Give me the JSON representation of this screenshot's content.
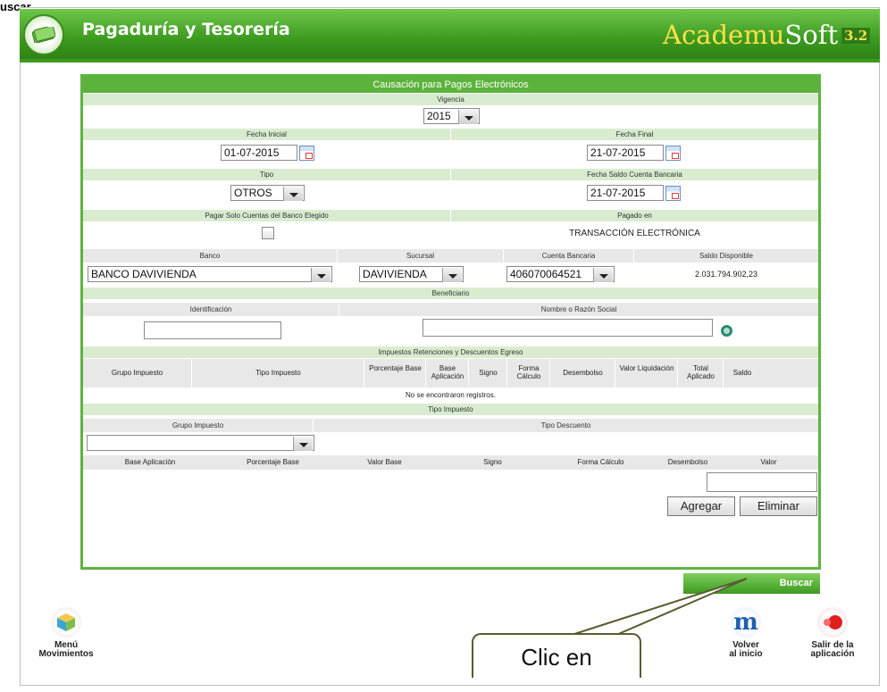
{
  "top_caption": "uscar.",
  "header": {
    "title": "Pagaduría y Tesorería",
    "brand_a": "Academu",
    "brand_b": "Soft",
    "brand_version": "3.2"
  },
  "form": {
    "title": "Causación para Pagos Electrónicos",
    "vigencia_label": "Vigencia",
    "vigencia_value": "2015",
    "fecha_inicial_label": "Fecha Inicial",
    "fecha_inicial_value": "01-07-2015",
    "fecha_final_label": "Fecha Final",
    "fecha_final_value": "21-07-2015",
    "tipo_label": "Tipo",
    "tipo_value": "OTROS",
    "fecha_saldo_label": "Fecha Saldo Cuenta Bancaria",
    "fecha_saldo_value": "21-07-2015",
    "pagar_label": "Pagar Solo Cuentas del Banco Elegido",
    "pagado_label": "Pagado en",
    "pagado_value": "TRANSACCIÓN ELECTRÓNICA",
    "banco_label": "Banco",
    "banco_value": "BANCO DAVIVIENDA",
    "sucursal_label": "Sucursal",
    "sucursal_value": "DAVIVIENDA",
    "cuenta_label": "Cuenta Bancaria",
    "cuenta_value": "406070064521",
    "saldo_label": "Saldo Disponible",
    "saldo_value": "2.031.794.902,23",
    "beneficiario_label": "Beneficiario",
    "identificacion_label": "Identificación",
    "nombre_label": "Nombre o Razón Social",
    "impuestos_label": "Impuestos Retenciones y Descuentos Egreso",
    "impuestos_columns": [
      "Grupo Impuesto",
      "Tipo Impuesto",
      "Porcentaje Base",
      "Base Aplicación",
      "Signo",
      "Forma Cálculo",
      "Desembolso",
      "Valor Liquidación",
      "Total Aplicado",
      "Saldo"
    ],
    "no_records": "No se encontraron registros.",
    "tipo_impuesto_label": "Tipo Impuesto",
    "grupo_impuesto_label": "Grupo Impuesto",
    "tipo_descuento_label": "Tipo Descuento",
    "detalle_columns": [
      "Base Aplicación",
      "Porcentaje Base",
      "Valor Base",
      "Signo",
      "Forma Cálculo",
      "Desembolso",
      "Valor"
    ],
    "agregar_label": "Agregar",
    "eliminar_label": "Eliminar"
  },
  "buscar_label": "Buscar",
  "nav": {
    "menu_line1": "Menú",
    "menu_line2": "Movimientos",
    "volver_line1": "Volver",
    "volver_line2": "al inicio",
    "salir_line1": "Salir de la",
    "salir_line2": "aplicación"
  },
  "callout_text": "Clic en"
}
